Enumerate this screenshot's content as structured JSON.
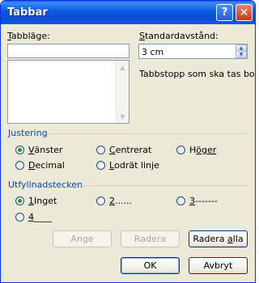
{
  "window": {
    "title": "Tabbar"
  },
  "titlebar": {
    "help_label": "?",
    "close_label": "✕"
  },
  "tab_position": {
    "label_prefix": "T",
    "label_rest": "abbläge:",
    "value": ""
  },
  "default_spacing": {
    "label_prefix": "S",
    "label_rest": "tandardavstånd:",
    "value": "3 cm"
  },
  "clear_info": "Tabbstopp som ska tas bort:",
  "alignment": {
    "title": "Justering",
    "options": [
      {
        "key": "V",
        "rest": "änster",
        "selected": true
      },
      {
        "key": "C",
        "rest": "entrerat",
        "selected": false
      },
      {
        "key": "H",
        "rest": "öger",
        "selected": false
      },
      {
        "key": "D",
        "rest": "ecimal",
        "selected": false
      },
      {
        "key": "L",
        "rest": "odrät linje",
        "selected": false
      }
    ]
  },
  "leader": {
    "title": "Utfyllnadstecken",
    "options": [
      {
        "key": "1",
        "rest": " Inget",
        "selected": true
      },
      {
        "key": "2",
        "rest": " ......",
        "selected": false
      },
      {
        "key": "3",
        "rest": " -------",
        "selected": false
      },
      {
        "key": "4",
        "rest": " ____",
        "selected": false
      }
    ]
  },
  "buttons": {
    "set": "Ange",
    "clear": "Radera",
    "clear_all_prefix": "Radera ",
    "clear_all_key": "a",
    "clear_all_rest": "lla",
    "ok": "OK",
    "cancel": "Avbryt"
  }
}
